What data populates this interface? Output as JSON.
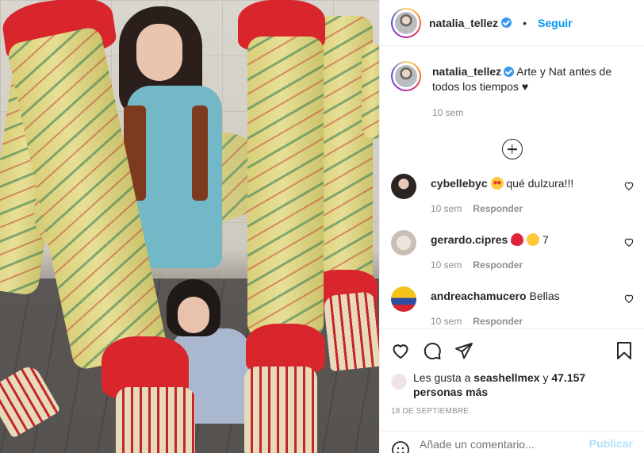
{
  "post": {
    "username": "natalia_tellez",
    "follow_label": "Seguir",
    "separator": "•"
  },
  "caption": {
    "username": "natalia_tellez",
    "text": "Arte y Nat antes de todos los tiempos ♥",
    "time": "10 sem"
  },
  "comments": [
    {
      "username": "cybellebyc",
      "text": "qué dulzura!!!",
      "time": "10 sem",
      "reply": "Responder",
      "emoji": "heart-eyes-emoji"
    },
    {
      "username": "gerardo.cipres",
      "text": "7",
      "time": "10 sem",
      "reply": "Responder",
      "emoji": "red-heart-and-face-emoji"
    },
    {
      "username": "andreachamucero",
      "text": "Bellas",
      "time": "10 sem",
      "reply": "Responder"
    }
  ],
  "likes": {
    "prefix": "Les gusta a",
    "user": "seashellmex",
    "conj": "y",
    "count": "47.157 personas más"
  },
  "date": "18 DE SEPTIEMBRE",
  "add_comment": {
    "placeholder": "Añade un comentario...",
    "publish_label": "Publicar"
  },
  "colors": {
    "accent": "#0095f6",
    "muted": "#8e8e8e",
    "heart": "#ed4956"
  },
  "icons": [
    "verified-badge-icon",
    "add-circle-icon",
    "heart-icon",
    "comment-icon",
    "share-icon",
    "bookmark-icon",
    "emoji-icon"
  ]
}
